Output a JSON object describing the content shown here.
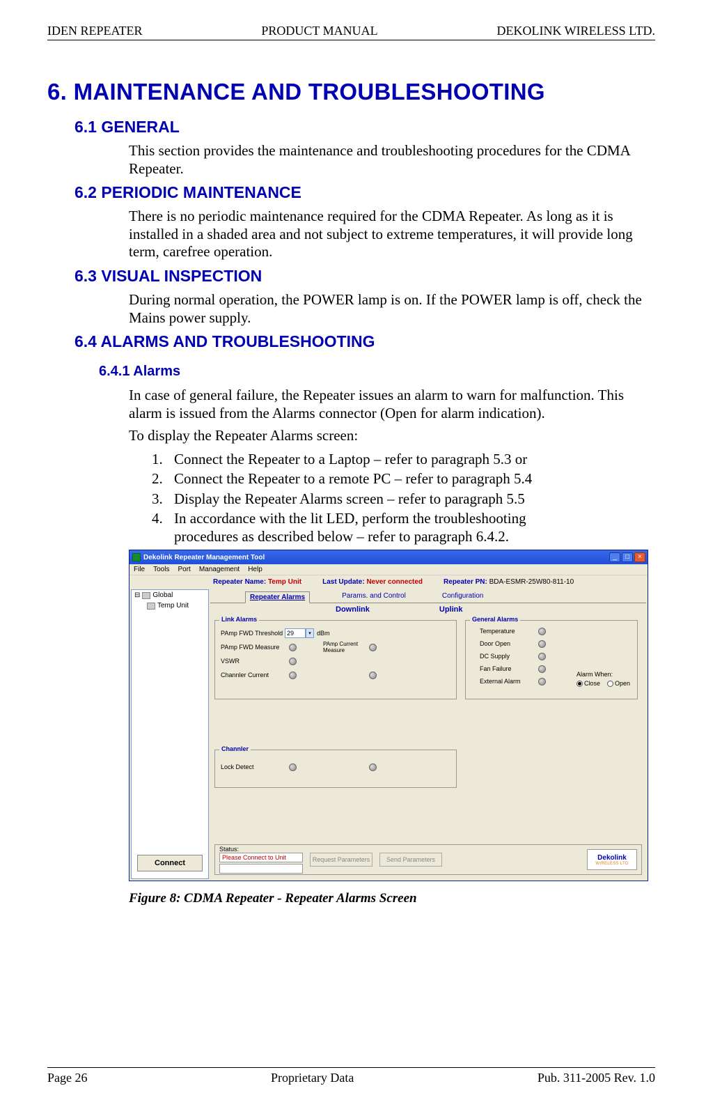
{
  "header": {
    "left": "IDEN REPEATER",
    "center": "PRODUCT MANUAL",
    "right": "DEKOLINK WIRELESS LTD."
  },
  "h1": "6. MAINTENANCE AND TROUBLESHOOTING",
  "s61": {
    "title": "6.1 GENERAL",
    "body": "This section provides the maintenance and troubleshooting procedures for the CDMA Repeater."
  },
  "s62": {
    "title": "6.2 PERIODIC MAINTENANCE",
    "body": "There is no periodic maintenance required for the CDMA Repeater. As long as it is installed in a shaded area and not subject to extreme temperatures, it will provide long term, carefree operation."
  },
  "s63": {
    "title": "6.3 VISUAL INSPECTION",
    "body": "During normal operation, the POWER lamp is on.  If the POWER lamp is off, check the Mains power supply."
  },
  "s64": {
    "title": "6.4 ALARMS AND TROUBLESHOOTING"
  },
  "s641": {
    "title": "6.4.1 Alarms",
    "p1": "In case of general failure, the Repeater issues an alarm to warn for malfunction.  This alarm is issued from the Alarms connector (Open for alarm indication).",
    "p2": "To display the Repeater Alarms screen:",
    "list": {
      "n1": "1.",
      "t1": "Connect the Repeater to a Laptop – refer to paragraph 5.3 or",
      "n2": "2.",
      "t2": "Connect the Repeater to a remote PC – refer to paragraph 5.4",
      "n3": "3.",
      "t3": "Display the Repeater Alarms screen – refer to paragraph 5.5",
      "n4": "4.",
      "t4": "In accordance with the lit LED, perform the troubleshooting procedures as described below – refer to paragraph 6.4.2."
    }
  },
  "figcap": "Figure 8: CDMA Repeater - Repeater Alarms Screen",
  "footer": {
    "left": "Page 26",
    "center": "Proprietary Data",
    "right": "Pub. 311-2005 Rev. 1.0"
  },
  "shot": {
    "title": "Dekolink Repeater Management Tool",
    "menus": {
      "m1": "File",
      "m2": "Tools",
      "m3": "Port",
      "m4": "Management",
      "m5": "Help"
    },
    "info": {
      "rn_lbl": "Repeater Name:",
      "rn_val": "Temp Unit",
      "lu_lbl": "Last Update:",
      "lu_val": "Never connected",
      "pn_lbl": "Repeater PN:",
      "pn_val": "BDA-ESMR-25W80-811-10"
    },
    "tree": {
      "global": "Global",
      "unit": "Temp Unit"
    },
    "connect": "Connect",
    "tabs": {
      "t1": "Repeater Alarms",
      "t2": "Params. and Control",
      "t3": "Configuration"
    },
    "cols": {
      "dl": "Downlink",
      "ul": "Uplink"
    },
    "link_alarms": {
      "legend": "Link Alarms",
      "r1": "PAmp FWD Threshold",
      "thresh": "29",
      "unit": "dBm",
      "r2": "PAmp FWD Measure",
      "r2b": "PAmp Current Measure",
      "r3": "VSWR",
      "r4": "Channler Current"
    },
    "general_alarms": {
      "legend": "General Alarms",
      "g1": "Temperature",
      "g2": "Door Open",
      "g3": "DC Supply",
      "g4": "Fan Failure",
      "g5": "External Alarm",
      "aw_lbl": "Alarm When:",
      "aw_close": "Close",
      "aw_open": "Open"
    },
    "channeler": {
      "legend": "Channler",
      "row": "Lock Detect"
    },
    "status": {
      "lbl": "Status:",
      "msg": "Please Connect to Unit",
      "btn1": "Request Parameters",
      "btn2": "Send Parameters",
      "logo_main": "Dekolink",
      "logo_sub": "WIRELESS LTD"
    }
  }
}
